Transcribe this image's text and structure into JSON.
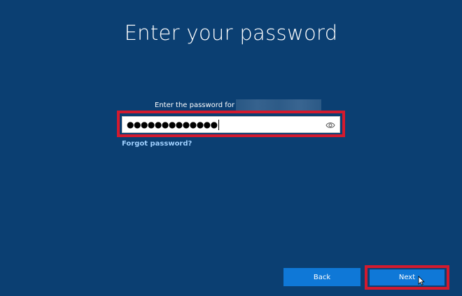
{
  "page": {
    "title": "Enter your password"
  },
  "password_form": {
    "prompt": "Enter the password for",
    "password_masked": "●●●●●●●●●●●●●",
    "forgot_link": "Forgot password?"
  },
  "footer": {
    "back_label": "Back",
    "next_label": "Next"
  },
  "colors": {
    "background": "#0b3f72",
    "button": "#0f78d7",
    "highlight": "#d41a2e",
    "link": "#9fd0ff"
  },
  "icons": {
    "reveal": "eye-icon",
    "pointer": "cursor-icon"
  }
}
